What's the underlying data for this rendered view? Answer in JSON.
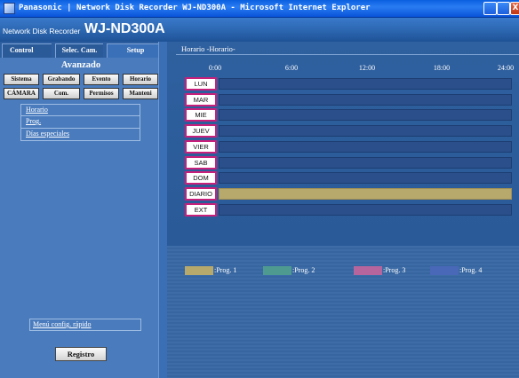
{
  "window": {
    "title": "Panasonic | Network Disk Recorder WJ-ND300A - Microsoft Internet Explorer",
    "close_glyph": "X"
  },
  "header": {
    "subtitle": "Network Disk Recorder",
    "model": "WJ-ND300A"
  },
  "tabs": [
    {
      "label": "Control"
    },
    {
      "label": "Selec. Cam."
    },
    {
      "label": "Setup"
    }
  ],
  "section_title": "Avanzado",
  "setup_buttons": [
    "Sistema",
    "Grabando",
    "Evento",
    "Horario",
    "CÁMARA",
    "Com.",
    "Permisos",
    "Manteni"
  ],
  "menu_links": [
    "Horario",
    "Prog.",
    "Días especiales"
  ],
  "quick_menu": "Menú config. rápido",
  "register_button": "Registro",
  "schedule": {
    "title": "Horario -Horario-",
    "hours": [
      "0:00",
      "6:00",
      "12:00",
      "18:00",
      "24:00"
    ],
    "rows": [
      {
        "day": "LUN",
        "program": null
      },
      {
        "day": "MAR",
        "program": null
      },
      {
        "day": "MIE",
        "program": null
      },
      {
        "day": "JUEV",
        "program": null
      },
      {
        "day": "VIER",
        "program": null
      },
      {
        "day": "SAB",
        "program": null
      },
      {
        "day": "DOM",
        "program": null
      },
      {
        "day": "DIARIO",
        "program": 1
      },
      {
        "day": "EXT",
        "program": null
      }
    ]
  },
  "legend": [
    {
      "label": ":Prog. 1",
      "color": "#b7a86c"
    },
    {
      "label": ":Prog. 2",
      "color": "#4f9a90"
    },
    {
      "label": ":Prog. 3",
      "color": "#b6669c"
    },
    {
      "label": ":Prog. 4",
      "color": "#4968b8"
    }
  ]
}
